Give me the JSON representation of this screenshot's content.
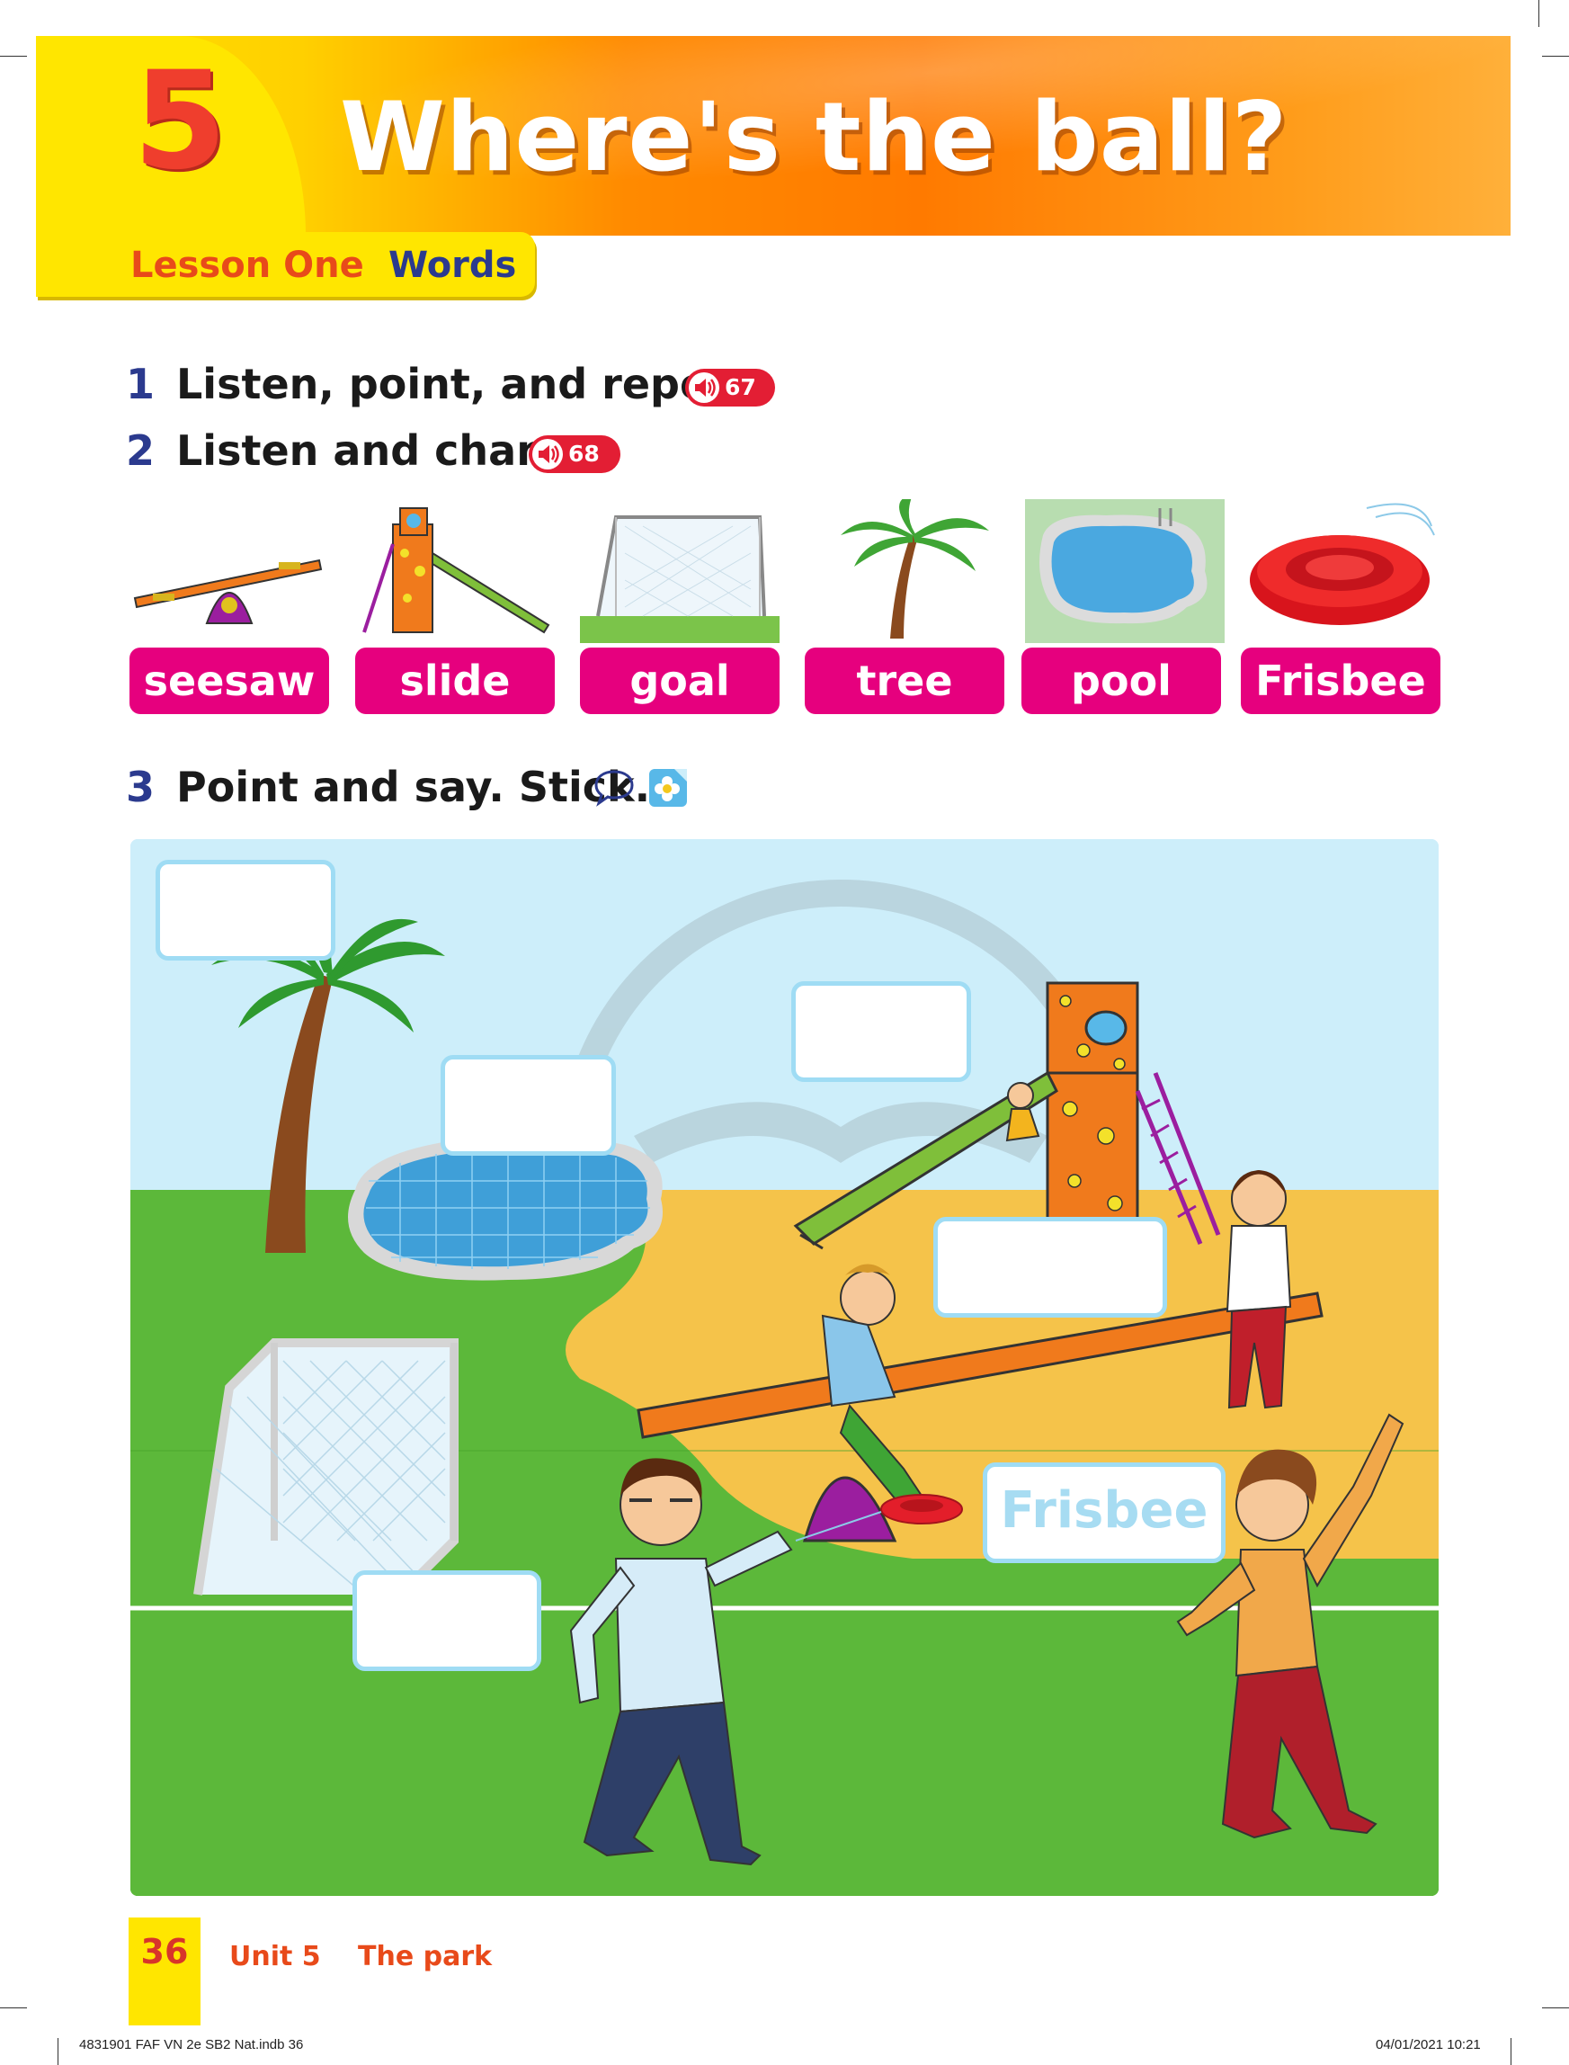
{
  "header": {
    "unit_number": "5",
    "title": "Where's the ball?",
    "lesson_label": "Lesson One",
    "lesson_type": "Words"
  },
  "activities": [
    {
      "number": "1",
      "text": "Listen, point, and repeat.",
      "track": "67"
    },
    {
      "number": "2",
      "text": "Listen and chant.",
      "track": "68"
    },
    {
      "number": "3",
      "text": "Point and say. Stick."
    }
  ],
  "words": [
    "seesaw",
    "slide",
    "goal",
    "tree",
    "pool",
    "Frisbee"
  ],
  "scene": {
    "filled_label": "Frisbee"
  },
  "footer": {
    "page_number": "36",
    "unit": "Unit 5",
    "topic": "The park",
    "slug_left": "4831901 FAF VN 2e SB2 Nat.indb   36",
    "slug_right": "04/01/2021   10:21"
  },
  "colors": {
    "header_orange": "#ff8a00",
    "header_yellow": "#ffe600",
    "word_button": "#e6007e",
    "number_blue": "#2b3a8e",
    "audio_red": "#e31e34"
  }
}
